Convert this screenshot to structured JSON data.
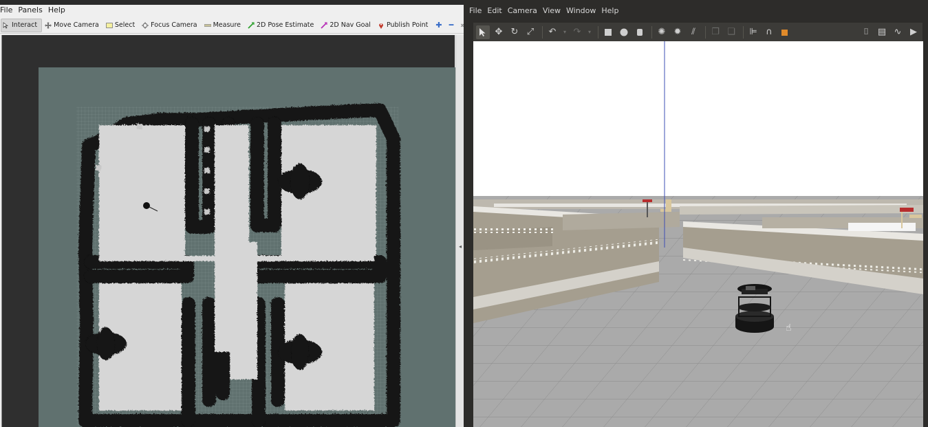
{
  "rviz": {
    "menu": [
      {
        "label": "File",
        "id": "file"
      },
      {
        "label": "Panels",
        "id": "panels"
      },
      {
        "label": "Help",
        "id": "help"
      }
    ],
    "tools": [
      {
        "label": "Interact",
        "icon": "cursor-icon",
        "id": "interact",
        "active": true
      },
      {
        "label": "Move Camera",
        "icon": "move-camera-icon",
        "id": "move-camera"
      },
      {
        "label": "Select",
        "icon": "select-icon",
        "id": "select"
      },
      {
        "label": "Focus Camera",
        "icon": "focus-camera-icon",
        "id": "focus-camera"
      },
      {
        "label": "Measure",
        "icon": "measure-icon",
        "id": "measure"
      },
      {
        "label": "2D Pose Estimate",
        "icon": "pose-estimate-icon",
        "id": "2d-pose-estimate"
      },
      {
        "label": "2D Nav Goal",
        "icon": "nav-goal-icon",
        "id": "2d-nav-goal"
      },
      {
        "label": "Publish Point",
        "icon": "publish-point-icon",
        "id": "publish-point"
      }
    ],
    "toolbar_extras": {
      "add": "✚",
      "remove": "━",
      "more": "»"
    },
    "colors": {
      "map_background": "#60716f",
      "free_space": "#d6d6d6",
      "costmap_wall": "#111111",
      "grid": "#8fa3a1"
    }
  },
  "gazebo": {
    "menu": [
      {
        "label": "File",
        "id": "file"
      },
      {
        "label": "Edit",
        "id": "edit"
      },
      {
        "label": "Camera",
        "id": "camera"
      },
      {
        "label": "View",
        "id": "view"
      },
      {
        "label": "Window",
        "id": "window"
      },
      {
        "label": "Help",
        "id": "help"
      }
    ],
    "toolbar_icons": [
      "select-mode-icon",
      "translate-icon",
      "rotate-icon",
      "scale-icon",
      "undo-icon",
      "redo-icon",
      "box-icon",
      "sphere-icon",
      "cylinder-icon",
      "point-light-icon",
      "spot-light-icon",
      "directional-light-icon",
      "copy-icon",
      "paste-icon",
      "align-icon",
      "snap-icon",
      "view-angle-icon",
      "screenshot-icon",
      "log-icon",
      "plot-icon",
      "record-video-icon"
    ],
    "colors": {
      "sky": "#ffffff",
      "floor": "#a9a9a9",
      "wall_side": "#a19a8c",
      "wall_top": "#e8e6e1",
      "robot": "#141414"
    }
  }
}
